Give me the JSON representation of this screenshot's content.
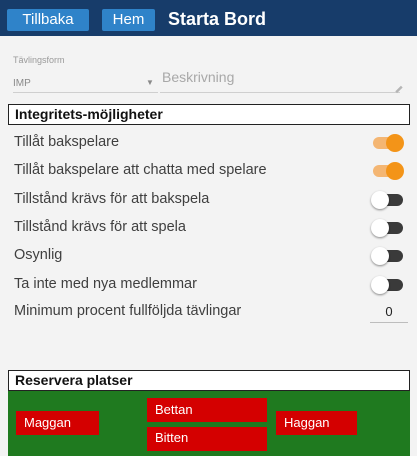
{
  "header": {
    "back_label": "Tillbaka",
    "home_label": "Hem",
    "title": "Starta Bord"
  },
  "form": {
    "competition_label": "Tävlingsform",
    "competition_value": "IMP",
    "description_placeholder": "Beskrivning"
  },
  "privacy": {
    "heading": "Integritets-möjligheter",
    "options": [
      {
        "label": "Tillåt bakspelare",
        "on": true
      },
      {
        "label": "Tillåt bakspelare att chatta med spelare",
        "on": true
      },
      {
        "label": "Tillstånd krävs för att bakspela",
        "on": false
      },
      {
        "label": "Tillstånd krävs för att spela",
        "on": false
      },
      {
        "label": "Osynlig",
        "on": false
      },
      {
        "label": "Ta inte med nya medlemmar",
        "on": false
      }
    ],
    "min_percent_label": "Minimum procent fullföljda tävlingar",
    "min_percent_value": "0"
  },
  "reserve": {
    "heading": "Reservera platser",
    "seats": {
      "north": "Bettan",
      "west": "Maggan",
      "east": "Haggan",
      "south": "Bitten"
    }
  },
  "colors": {
    "header_bg": "#173c6a",
    "button_bg": "#2f83c9",
    "toggle_on": "#f39418",
    "table_green": "#1f7a1f",
    "seat_red": "#d40000"
  }
}
